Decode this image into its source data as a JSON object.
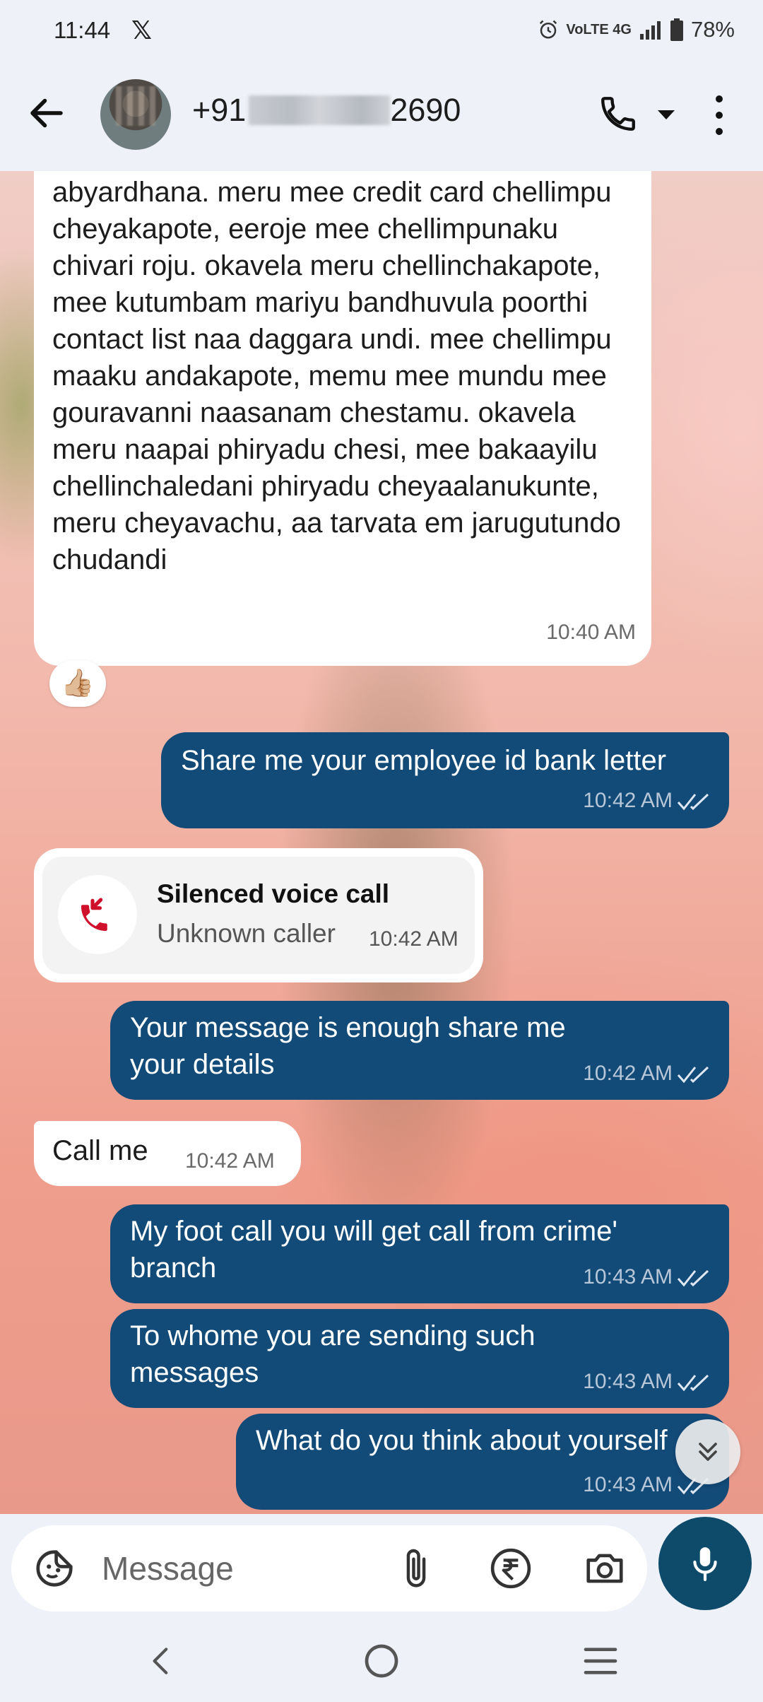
{
  "status_bar": {
    "time": "11:44",
    "app_icon": "x-logo",
    "indicators": "VoLTE 4G",
    "battery": "78%"
  },
  "header": {
    "contact_prefix": "+91",
    "contact_suffix": "2690"
  },
  "messages": [
    {
      "id": "m1",
      "direction": "incoming",
      "text": "abyardhana. meru mee credit card chellimpu cheyakapote, eeroje mee chellimpunaku chivari roju. okavela meru chellinchakapote, mee kutumbam mariyu bandhuvula poorthi contact list naa daggara undi. mee chellimpu maaku andakapote, memu mee mundu mee gouravanni naasanam chestamu. okavela meru naapai phiryadu chesi, mee bakaayilu chellinchaledani phiryadu cheyaalanukunte, meru cheyavachu, aa tarvata em jarugutundo chudandi",
      "time": "10:40 AM",
      "reaction": "👍🏼"
    },
    {
      "id": "m2",
      "direction": "outgoing",
      "text": "Share me your employee id bank letter",
      "time": "10:42 AM"
    },
    {
      "id": "m3",
      "direction": "incoming-call",
      "title": "Silenced voice call",
      "subtitle": "Unknown caller",
      "time": "10:42 AM"
    },
    {
      "id": "m4",
      "direction": "outgoing",
      "text": "Your message is enough share me your details",
      "time": "10:42 AM"
    },
    {
      "id": "m5",
      "direction": "incoming",
      "text": "Call me",
      "time": "10:42 AM"
    },
    {
      "id": "m6",
      "direction": "outgoing",
      "text": "My foot call you will get call from crime' branch",
      "time": "10:43 AM"
    },
    {
      "id": "m7",
      "direction": "outgoing",
      "text": "To whome you are sending such messages",
      "time": "10:43 AM"
    },
    {
      "id": "m8",
      "direction": "outgoing",
      "text": "What do you think about yourself",
      "time": "10:43 AM"
    }
  ],
  "compose": {
    "placeholder": "Message"
  },
  "colors": {
    "outgoing_bubble": "#124a78",
    "incoming_bubble": "#ffffff",
    "mic_button": "#0e4b6b",
    "missed_call_red": "#d0112b"
  }
}
